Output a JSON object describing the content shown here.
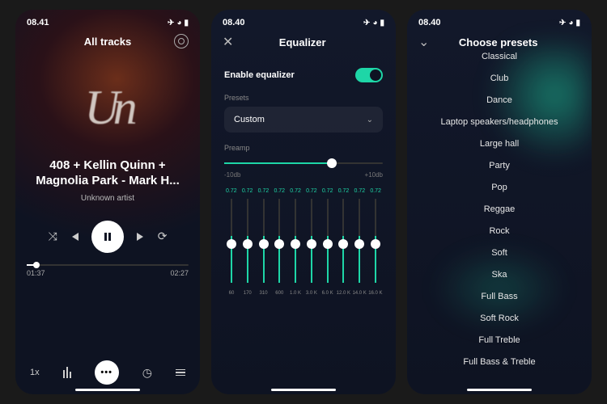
{
  "status": {
    "time1": "08.41",
    "time2": "08.40",
    "time3": "08.40"
  },
  "player": {
    "header": "All tracks",
    "art_text": "Un",
    "track": "408 + Kellin Quinn + Magnolia Park - Mark H...",
    "artist": "Unknown artist",
    "elapsed": "01:37",
    "total": "02:27",
    "speed": "1x"
  },
  "equalizer": {
    "header": "Equalizer",
    "enable_label": "Enable equalizer",
    "presets_label": "Presets",
    "preset_selected": "Custom",
    "preamp_label": "Preamp",
    "preamp_min": "-10db",
    "preamp_max": "+10db",
    "band_value": "0.72",
    "freqs": [
      "60",
      "170",
      "310",
      "600",
      "1.0 K",
      "3.0 K",
      "6.0 K",
      "12.0 K",
      "14.0 K",
      "16.0 K"
    ]
  },
  "presets": {
    "header": "Choose presets",
    "items": [
      "Classical",
      "Club",
      "Dance",
      "Laptop speakers/headphones",
      "Large hall",
      "Party",
      "Pop",
      "Reggae",
      "Rock",
      "Soft",
      "Ska",
      "Full Bass",
      "Soft Rock",
      "Full Treble",
      "Full Bass & Treble"
    ]
  }
}
